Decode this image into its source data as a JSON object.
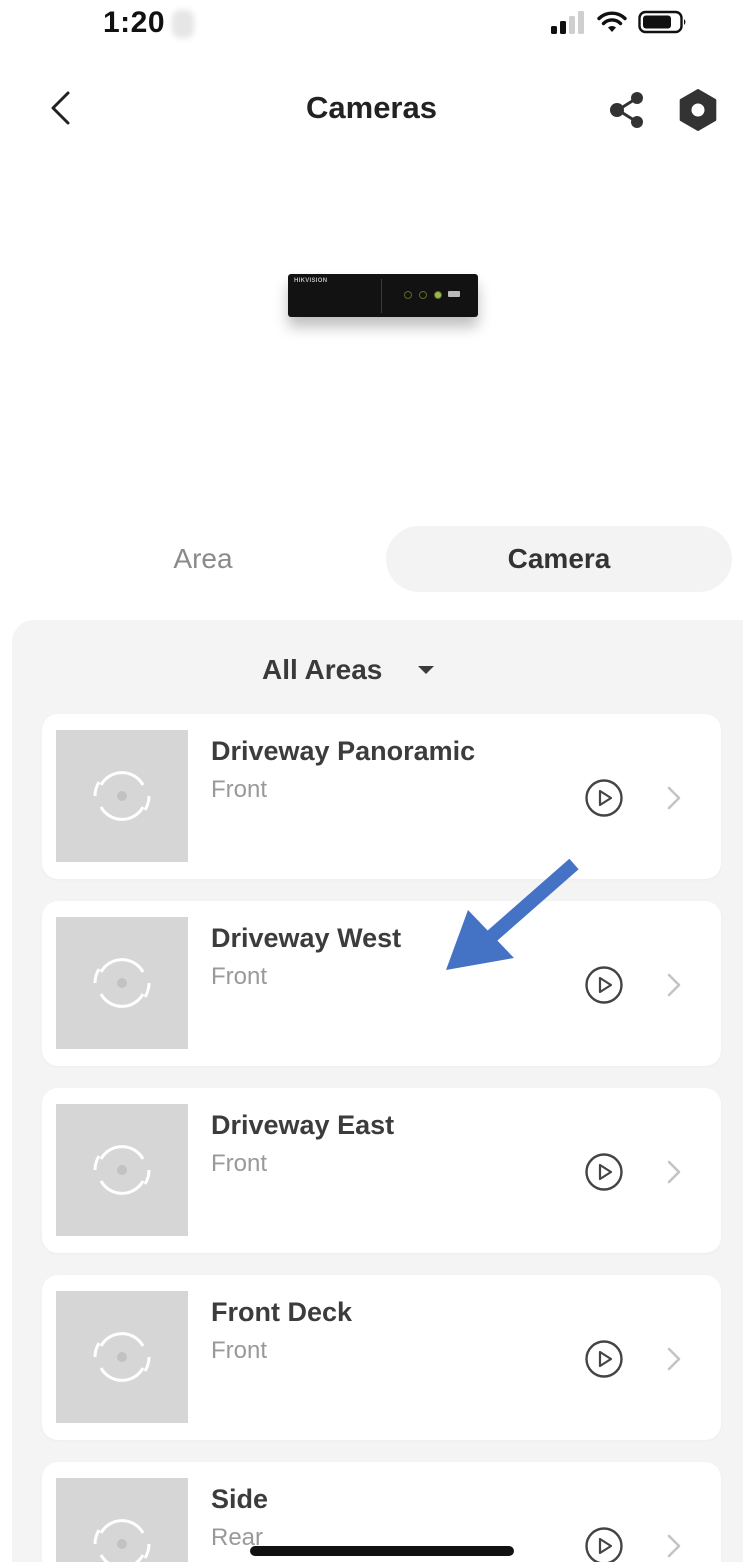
{
  "status_bar": {
    "time": "1:20"
  },
  "nav": {
    "title": "Cameras",
    "back_icon": "chevron-left-icon",
    "share_icon": "share-icon",
    "settings_icon": "hexagon-settings-icon"
  },
  "device": {
    "brand": "HIKVISION"
  },
  "tabs": [
    {
      "label": "Area",
      "selected": false
    },
    {
      "label": "Camera",
      "selected": true
    }
  ],
  "filter": {
    "label": "All Areas"
  },
  "cameras": [
    {
      "name": "Driveway Panoramic",
      "area": "Front"
    },
    {
      "name": "Driveway West",
      "area": "Front"
    },
    {
      "name": "Driveway East",
      "area": "Front"
    },
    {
      "name": "Front Deck",
      "area": "Front"
    },
    {
      "name": "Side",
      "area": "Rear"
    }
  ],
  "colors": {
    "annotation_arrow": "#4472C4",
    "panel_bg": "#f4f4f4",
    "thumb_bg": "#d6d6d6",
    "selected_tab_bg": "#f3f3f3"
  }
}
